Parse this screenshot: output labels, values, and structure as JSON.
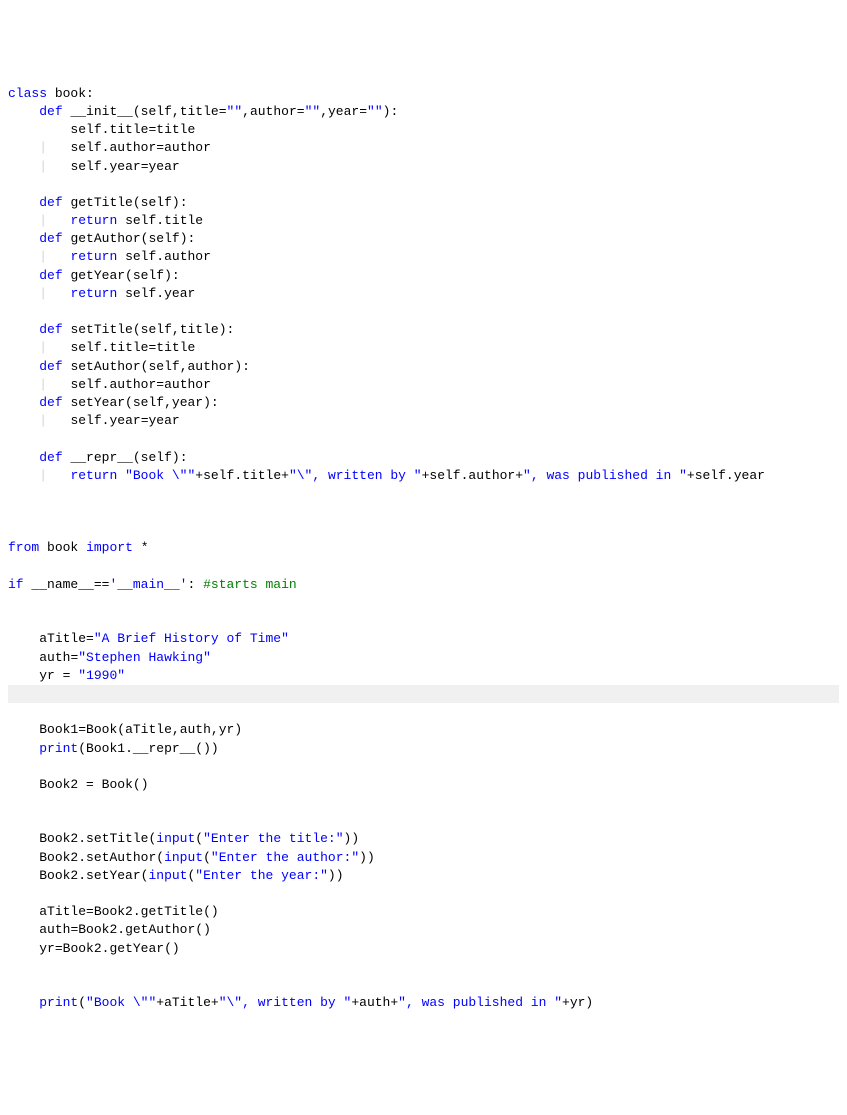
{
  "code": {
    "t_class": "class",
    "t_book": "book",
    "colon": ":",
    "t_def": "def",
    "t_init": "__init__",
    "t_self": "self",
    "t_title": "title",
    "t_author": "author",
    "t_year": "year",
    "eq": "=",
    "emptystr": "\"\"",
    "comma": ",",
    "oparen": "(",
    "cparen": ")",
    "dot": ".",
    "t_return": "return",
    "t_getTitle": "getTitle",
    "t_getAuthor": "getAuthor",
    "t_getYear": "getYear",
    "t_setTitle": "setTitle",
    "t_setAuthor": "setAuthor",
    "t_setYear": "setYear",
    "t_repr": "__repr__",
    "repr_str1": "\"Book \\\"\"",
    "repr_str2": "\"\\\", written by \"",
    "repr_str3": "\", was published in \"",
    "plus": "+",
    "t_from": "from",
    "t_import": "import",
    "star": "*",
    "t_if": "if",
    "t_name": "__name__",
    "eqeq": "==",
    "main_str": "'__main__'",
    "cmt_main": "#starts main",
    "t_aTitle": "aTitle",
    "str_abht": "\"A Brief History of Time\"",
    "t_auth": "auth",
    "str_hawking": "\"Stephen Hawking\"",
    "t_yr": "yr",
    "str_1990": "\"1990\"",
    "t_Book1": "Book1",
    "t_Book": "Book",
    "t_print": "print",
    "t_Book2": "Book2",
    "t_input": "input",
    "str_entitle": "\"Enter the title:\"",
    "str_enauthor": "\"Enter the author:\"",
    "str_enyear": "\"Enter the year:\"",
    "sp": " "
  }
}
